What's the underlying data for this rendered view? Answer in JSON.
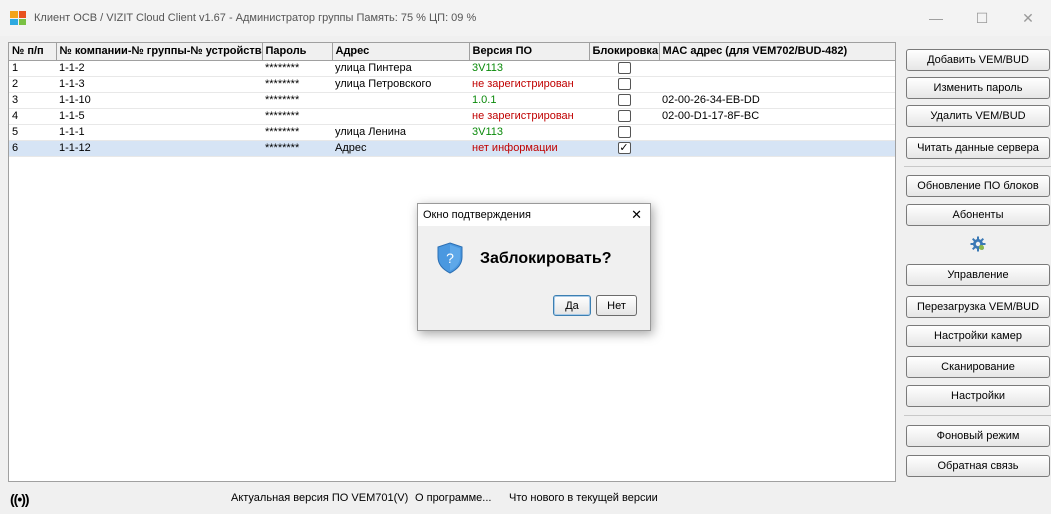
{
  "window": {
    "title": "Клиент ОСВ / VIZIT Cloud Client v1.67 - Администратор группы    Память: 75 % ЦП: 09 %",
    "controls": {
      "minimize": "—",
      "maximize": "☐",
      "close": "✕"
    },
    "icon_colors": [
      "#f2a31b",
      "#e8511e",
      "#2ea9e0",
      "#7ac143"
    ]
  },
  "table": {
    "columns": [
      "№ п/п",
      "№ компании-№ группы-№ устройства",
      "Пароль",
      "Адрес",
      "Версия ПО",
      "Блокировка",
      "МАС адрес (для VEM702/BUD-482)"
    ],
    "rows": [
      {
        "num": "1",
        "id": "1-1-2",
        "password": "********",
        "address": "улица Пинтера",
        "version": "3V113",
        "version_status": "ok",
        "blocked": false,
        "mac": ""
      },
      {
        "num": "2",
        "id": "1-1-3",
        "password": "********",
        "address": "улица Петровского",
        "version": "не зарегистрирован",
        "version_status": "error",
        "blocked": false,
        "mac": ""
      },
      {
        "num": "3",
        "id": "1-1-10",
        "password": "********",
        "address": "",
        "version": "1.0.1",
        "version_status": "ok",
        "blocked": false,
        "mac": "02-00-26-34-EB-DD"
      },
      {
        "num": "4",
        "id": "1-1-5",
        "password": "********",
        "address": "",
        "version": "не зарегистрирован",
        "version_status": "error",
        "blocked": false,
        "mac": "02-00-D1-17-8F-BC"
      },
      {
        "num": "5",
        "id": "1-1-1",
        "password": "********",
        "address": "улица Ленина",
        "version": "3V113",
        "version_status": "ok",
        "blocked": false,
        "mac": ""
      },
      {
        "num": "6",
        "id": "1-1-12",
        "password": "********",
        "address": "Адрес",
        "version": "нет информации",
        "version_status": "error",
        "blocked": true,
        "mac": ""
      }
    ],
    "selected_row": 5,
    "colors": {
      "ok": "#0a8a0a",
      "error": "#c00000",
      "selection": "#d6e4f5"
    }
  },
  "sidebar": {
    "buttons": {
      "add": "Добавить VEM/BUD",
      "change_password": "Изменить пароль",
      "delete": "Удалить VEM/BUD",
      "read_server": "Читать данные сервера",
      "update_firmware": "Обновление ПО блоков",
      "subscribers": "Абоненты",
      "control": "Управление",
      "reboot": "Перезагрузка VEM/BUD",
      "camera_settings": "Настройки камер",
      "scan": "Сканирование",
      "settings": "Настройки",
      "background": "Фоновый режим",
      "feedback": "Обратная связь"
    },
    "gear_icon": "gear-icon"
  },
  "status": {
    "radio_icon": "((•))",
    "current_version": "Актуальная версия ПО VEM701(V)",
    "about": "О программе...",
    "whats_new": "Что нового в текущей версии"
  },
  "dialog": {
    "title": "Окно подтверждения",
    "close": "✕",
    "icon": "?",
    "message": "Заблокировать?",
    "yes": "Да",
    "no": "Нет"
  }
}
